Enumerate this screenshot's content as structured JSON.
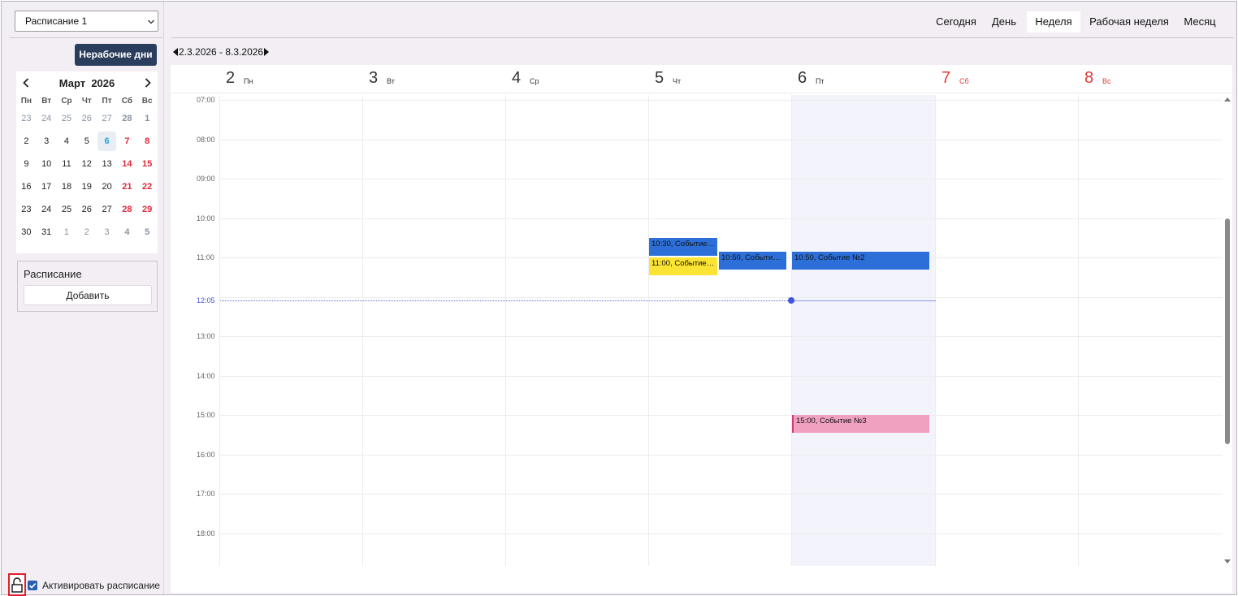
{
  "left": {
    "schedule_select": "Расписание 1",
    "nonworking_days_button": "Нерабочие дни",
    "mini_calendar": {
      "month": "Март",
      "year": "2026",
      "weekdays": [
        "Пн",
        "Вт",
        "Ср",
        "Чт",
        "Пт",
        "Сб",
        "Вс"
      ],
      "weeks": [
        [
          "23",
          "24",
          "25",
          "26",
          "27",
          "28",
          "1"
        ],
        [
          "2",
          "3",
          "4",
          "5",
          "6",
          "7",
          "8"
        ],
        [
          "9",
          "10",
          "11",
          "12",
          "13",
          "14",
          "15"
        ],
        [
          "16",
          "17",
          "18",
          "19",
          "20",
          "21",
          "22"
        ],
        [
          "23",
          "24",
          "25",
          "26",
          "27",
          "28",
          "29"
        ],
        [
          "30",
          "31",
          "1",
          "2",
          "3",
          "4",
          "5"
        ]
      ],
      "today": "6"
    },
    "schedule_section": {
      "title": "Расписание",
      "add_button": "Добавить"
    },
    "activate_label": "Активировать расписание",
    "activate_checked": true
  },
  "views": {
    "today": "Сегодня",
    "day": "День",
    "week": "Неделя",
    "work_week": "Рабочая неделя",
    "month": "Месяц",
    "active": "Неделя"
  },
  "range": {
    "label": "2.3.2026 - 8.3.2026"
  },
  "days": [
    {
      "num": "2",
      "name": "Пн",
      "weekend": false
    },
    {
      "num": "3",
      "name": "Вт",
      "weekend": false
    },
    {
      "num": "4",
      "name": "Ср",
      "weekend": false
    },
    {
      "num": "5",
      "name": "Чт",
      "weekend": false
    },
    {
      "num": "6",
      "name": "Пт",
      "weekend": false
    },
    {
      "num": "7",
      "name": "Сб",
      "weekend": true
    },
    {
      "num": "8",
      "name": "Вс",
      "weekend": true
    }
  ],
  "times": [
    "07:00",
    "08:00",
    "09:00",
    "10:00",
    "11:00",
    "12:00",
    "13:00",
    "14:00",
    "15:00",
    "16:00",
    "17:00",
    "18:00"
  ],
  "now": {
    "label": "12:05"
  },
  "events": [
    {
      "text": "10:30, Событие ...",
      "color": "#2d6fd8",
      "style": "blue"
    },
    {
      "text": "11:00, Событие ...",
      "color": "#fbe433",
      "style": "yellow"
    },
    {
      "text": "10:50, Событие ...",
      "color": "#2d6fd8",
      "style": "blue"
    },
    {
      "text": "10:50, Событие №2",
      "color": "#2d6fd8",
      "style": "blue"
    },
    {
      "text": "15:00, Событие №3",
      "color": "#f0a1c0",
      "style": "pink"
    }
  ],
  "colors": {
    "accent": "#2a3d5c",
    "weekend": "#e03a3a",
    "today": "#23a3d9",
    "now": "#3f55dd"
  }
}
